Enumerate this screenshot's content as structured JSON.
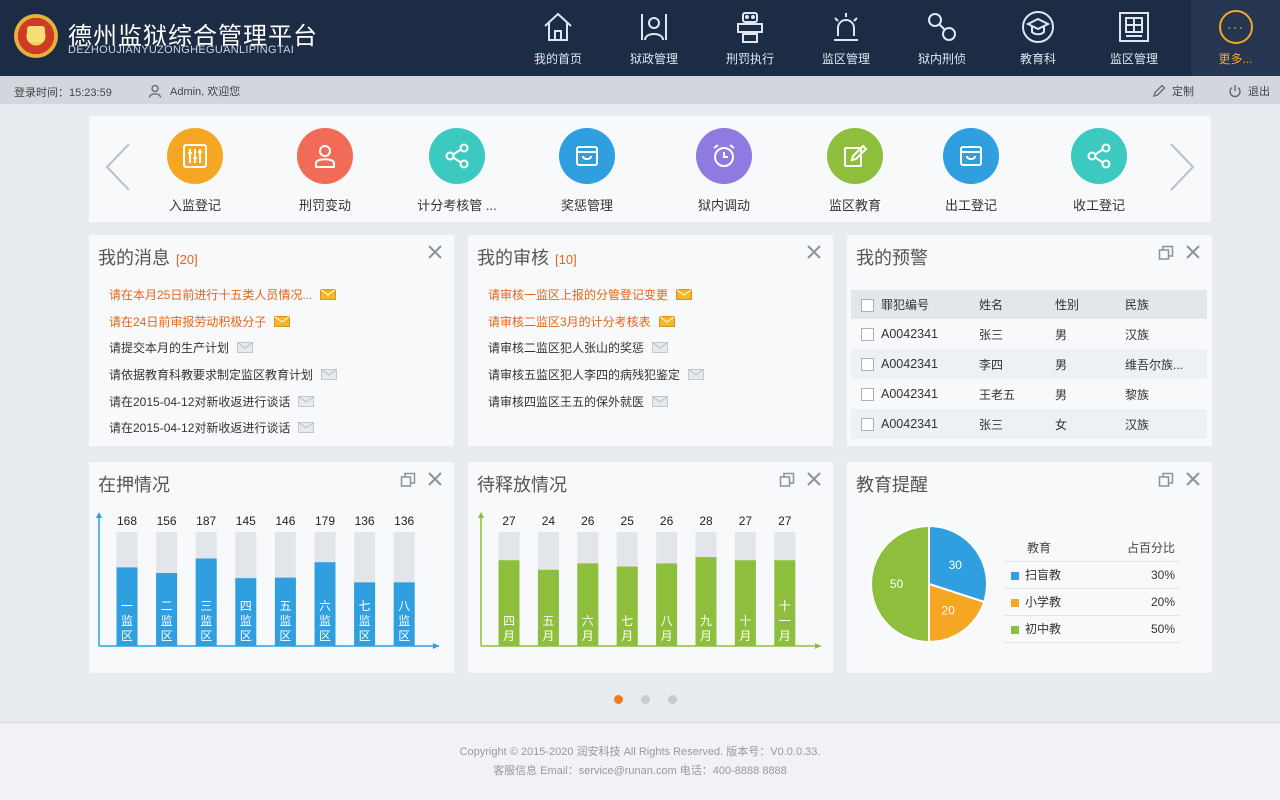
{
  "header": {
    "title": "德州监狱综合管理平台",
    "subtitle": "DEZHOUJIANYUZONGHEGUANLIPINGTAI",
    "nav": [
      {
        "label": "我的首页",
        "icon": "home-icon"
      },
      {
        "label": "狱政管理",
        "icon": "officer-icon"
      },
      {
        "label": "刑罚执行",
        "icon": "robot-icon"
      },
      {
        "label": "监区管理",
        "icon": "alarm-light-icon"
      },
      {
        "label": "狱内刑侦",
        "icon": "handcuffs-icon"
      },
      {
        "label": "教育科",
        "icon": "graduation-cap-icon"
      },
      {
        "label": "监区管理",
        "icon": "building-grid-icon"
      }
    ],
    "more_label": "更多...",
    "more_glyph": "···"
  },
  "status": {
    "login_time": "登录时间：15:23:59",
    "welcome": "Admin, 欢迎您",
    "customize": "定制",
    "logout": "退出"
  },
  "shortcuts": [
    {
      "label": "入监登记",
      "color": "#f5a623",
      "icon": "sliders-icon"
    },
    {
      "label": "刑罚变动",
      "color": "#f26b57",
      "icon": "person-icon"
    },
    {
      "label": "计分考核管 ...",
      "color": "#3cc9bf",
      "icon": "share-icon"
    },
    {
      "label": "奖惩管理",
      "color": "#2f9fe0",
      "icon": "cart-box-icon"
    },
    {
      "label": "狱内调动",
      "color": "#8e7ae0",
      "icon": "alarm-clock-icon"
    },
    {
      "label": "监区教育",
      "color": "#8dbf3d",
      "icon": "edit-icon"
    },
    {
      "label": "出工登记",
      "color": "#2f9fe0",
      "icon": "cart-box-icon"
    },
    {
      "label": "收工登记",
      "color": "#3cc9bf",
      "icon": "share-icon"
    }
  ],
  "messages": {
    "title": "我的消息",
    "count": "[20]",
    "items": [
      {
        "text": "请在本月25日前进行十五类人员情况...",
        "hot": true
      },
      {
        "text": "请在24日前审报劳动积极分子",
        "hot": true
      },
      {
        "text": "请提交本月的生产计划",
        "hot": false
      },
      {
        "text": "请依据教育科教要求制定监区教育计划",
        "hot": false
      },
      {
        "text": "请在2015-04-12对新收返进行谈话",
        "hot": false
      },
      {
        "text": "请在2015-04-12对新收返进行谈话",
        "hot": false
      }
    ]
  },
  "reviews": {
    "title": "我的审核",
    "count": "[10]",
    "items": [
      {
        "text": "请审核一监区上报的分管登记变更",
        "hot": true
      },
      {
        "text": "请审核二监区3月的计分考核表",
        "hot": true
      },
      {
        "text": "请审核二监区犯人张山的奖惩",
        "hot": false
      },
      {
        "text": "请审核五监区犯人李四的病残犯鉴定",
        "hot": false
      },
      {
        "text": "请审核四监区王五的保外就医",
        "hot": false
      }
    ]
  },
  "warnings": {
    "title": "我的预警",
    "columns": [
      "罪犯编号",
      "姓名",
      "性别",
      "民族"
    ],
    "rows": [
      [
        "A0042341",
        "张三",
        "男",
        "汉族"
      ],
      [
        "A0042341",
        "李四",
        "男",
        "维吾尔族..."
      ],
      [
        "A0042341",
        "王老五",
        "男",
        "黎族"
      ],
      [
        "A0042341",
        "张三",
        "女",
        "汉族"
      ]
    ]
  },
  "custody": {
    "title": "在押情况",
    "chart_data": {
      "type": "bar",
      "categories": [
        "一监区",
        "二监区",
        "三监区",
        "四监区",
        "五监区",
        "六监区",
        "七监区",
        "八监区"
      ],
      "values": [
        168,
        156,
        187,
        145,
        146,
        179,
        136,
        136
      ],
      "ylim": [
        0,
        190
      ],
      "color": "#2f9fe0"
    }
  },
  "release": {
    "title": "待释放情况",
    "chart_data": {
      "type": "bar",
      "categories": [
        "四月",
        "五月",
        "六月",
        "七月",
        "八月",
        "九月",
        "十月",
        "十一月"
      ],
      "values": [
        27,
        24,
        26,
        25,
        26,
        28,
        27,
        27
      ],
      "ylim": [
        0,
        28
      ],
      "color": "#8dbf3d"
    }
  },
  "education": {
    "title": "教育提醒",
    "header_cat": "教育",
    "header_pct": "占百分比",
    "chart_data": {
      "type": "pie",
      "categories": [
        "扫盲教",
        "小学教",
        "初中教"
      ],
      "values": [
        30,
        20,
        50
      ],
      "percent_labels": [
        "30%",
        "20%",
        "50%"
      ],
      "colors": [
        "#2f9fe0",
        "#f5a623",
        "#8dbf3d"
      ]
    }
  },
  "pager": {
    "pages": 3,
    "active": 0
  },
  "footer": {
    "line1": "Copyright © 2015-2020 润安科技 All Rights Reserved. 版本号：V0.0.0.33.",
    "line2": "客服信息 Email：service@runan.com 电话：400-8888 8888"
  }
}
